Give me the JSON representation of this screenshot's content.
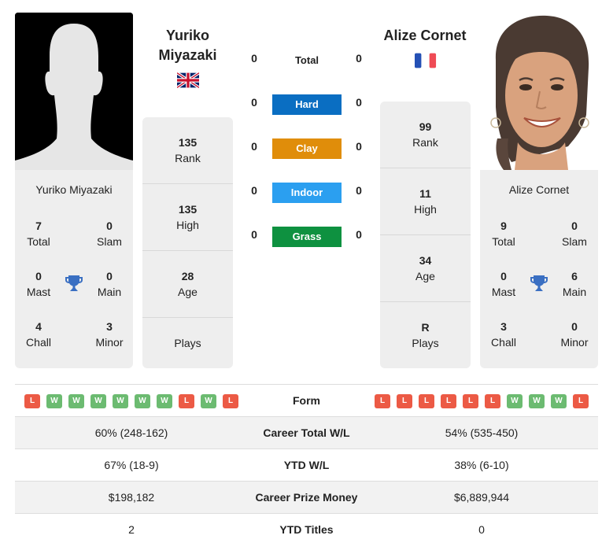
{
  "colors": {
    "hard": "#0a6ec2",
    "clay": "#e08d0a",
    "indoor": "#2b9ff0",
    "grass": "#0e9140",
    "win": "#6cbb71",
    "loss": "#ec5a45",
    "trophy": "#3a6fc2"
  },
  "player_left": {
    "name": "Yuriko Miyazaki",
    "name_line1": "Yuriko",
    "name_line2": "Miyazaki",
    "flag": "uk-flag",
    "card_name": "Yuriko Miyazaki",
    "titles": {
      "total": {
        "value": "7",
        "label": "Total"
      },
      "slam": {
        "value": "0",
        "label": "Slam"
      },
      "mast": {
        "value": "0",
        "label": "Mast"
      },
      "main": {
        "value": "0",
        "label": "Main"
      },
      "chall": {
        "value": "4",
        "label": "Chall"
      },
      "minor": {
        "value": "3",
        "label": "Minor"
      }
    },
    "rank": {
      "value": "135",
      "label": "Rank"
    },
    "high": {
      "value": "135",
      "label": "High"
    },
    "age": {
      "value": "28",
      "label": "Age"
    },
    "plays": {
      "value": "",
      "label": "Plays"
    },
    "form": [
      "L",
      "W",
      "W",
      "W",
      "W",
      "W",
      "W",
      "L",
      "W",
      "L"
    ]
  },
  "player_right": {
    "name": "Alize Cornet",
    "flag": "france-flag",
    "card_name": "Alize Cornet",
    "titles": {
      "total": {
        "value": "9",
        "label": "Total"
      },
      "slam": {
        "value": "0",
        "label": "Slam"
      },
      "mast": {
        "value": "0",
        "label": "Mast"
      },
      "main": {
        "value": "6",
        "label": "Main"
      },
      "chall": {
        "value": "3",
        "label": "Chall"
      },
      "minor": {
        "value": "0",
        "label": "Minor"
      }
    },
    "rank": {
      "value": "99",
      "label": "Rank"
    },
    "high": {
      "value": "11",
      "label": "High"
    },
    "age": {
      "value": "34",
      "label": "Age"
    },
    "plays": {
      "value": "R",
      "label": "Plays"
    },
    "form": [
      "L",
      "L",
      "L",
      "L",
      "L",
      "L",
      "W",
      "W",
      "W",
      "L"
    ]
  },
  "h2h": {
    "total": {
      "label": "Total",
      "left": "0",
      "right": "0"
    },
    "hard": {
      "label": "Hard",
      "left": "0",
      "right": "0"
    },
    "clay": {
      "label": "Clay",
      "left": "0",
      "right": "0"
    },
    "indoor": {
      "label": "Indoor",
      "left": "0",
      "right": "0"
    },
    "grass": {
      "label": "Grass",
      "left": "0",
      "right": "0"
    }
  },
  "table": {
    "form_label": "Form",
    "rows": [
      {
        "label": "Career Total W/L",
        "left": "60% (248-162)",
        "right": "54% (535-450)"
      },
      {
        "label": "YTD W/L",
        "left": "67% (18-9)",
        "right": "38% (6-10)"
      },
      {
        "label": "Career Prize Money",
        "left": "$198,182",
        "right": "$6,889,944"
      },
      {
        "label": "YTD Titles",
        "left": "2",
        "right": "0"
      }
    ]
  }
}
